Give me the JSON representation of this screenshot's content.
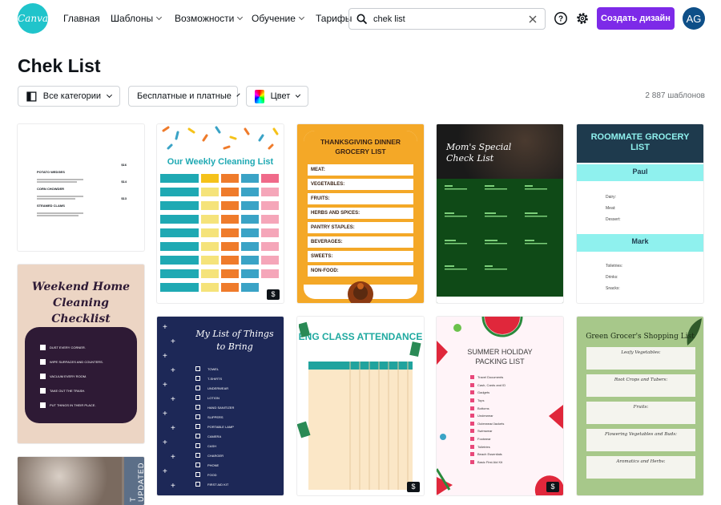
{
  "header": {
    "logo": "Canva",
    "nav": [
      "Главная",
      "Шаблоны",
      "Возможности",
      "Обучение",
      "Тарифы"
    ],
    "search_value": "chek list",
    "create_label": "Создать дизайн",
    "avatar": "AG"
  },
  "page": {
    "title": "Chek List",
    "filters": [
      "Все категории",
      "Бесплатные и платные",
      "Цвет"
    ],
    "count": "2 887 шаблонов"
  },
  "cards": {
    "menu": {
      "items": [
        {
          "name": "POTATO WEDGES",
          "price": "$16"
        },
        {
          "name": "CORN CHOWDER",
          "price": "$14"
        },
        {
          "name": "STEAMED CLAMS",
          "price": "$13"
        }
      ]
    },
    "weekend": {
      "title": "Weekend Home Cleaning Checklist",
      "items": [
        "DUST EVERY CORNER.",
        "WIPE SURFACES AND COUNTERS.",
        "VACUUM EVERY ROOM.",
        "TAKE OUT THE TRASH.",
        "PUT THINGS IN THEIR PLACE."
      ]
    },
    "updated": {
      "label": "T UPDATED"
    },
    "weekly": {
      "title": "Our Weekly Cleaning List"
    },
    "things": {
      "title": "My List of Things to Bring",
      "items": [
        "TOWEL",
        "T-SHIRTS",
        "UNDERWEAR",
        "LOTION",
        "HAND SANITIZER",
        "SLIPPERS",
        "PORTABLE LAMP",
        "CAMERA",
        "CASH",
        "CHARGER",
        "PHONE",
        "FOOD",
        "FIRST AID KIT"
      ]
    },
    "thanksgiving": {
      "title": "THANKSGIVING DINNER GROCERY LIST",
      "items": [
        "MEAT:",
        "VEGETABLES:",
        "FRUITS:",
        "HERBS AND SPICES:",
        "PANTRY STAPLES:",
        "BEVERAGES:",
        "SWEETS:",
        "NON-FOOD:"
      ]
    },
    "eng": {
      "title": "ENG CLASS ATTENDANCE"
    },
    "mom": {
      "title": "Mom's Special Check List"
    },
    "summer": {
      "title": "SUMMER HOLIDAY PACKING LIST",
      "items": [
        "Travel Documents",
        "Cash, Cards and ID",
        "Gadgets",
        "Tops",
        "Bottoms",
        "Underwear",
        "Outerwear/Jackets",
        "Swimwear",
        "Footwear",
        "Toiletries",
        "Beach Essentials",
        "Basic First Aid Kit"
      ]
    },
    "roommate": {
      "title": "ROOMMATE GROCERY LIST",
      "person1": "Paul",
      "labels1": [
        "Dairy:",
        "Meat:",
        "Dessert:"
      ],
      "person2": "Mark",
      "labels2": [
        "Toiletries:",
        "Drinks:",
        "Snacks:"
      ]
    },
    "green": {
      "title": "Green Grocer's Shopping List",
      "sections": [
        "Leafy Vegetables:",
        "Root Crops and Tubers:",
        "Fruits:",
        "Flowering Vegetables and Buds:",
        "Aromatics and Herbs:"
      ]
    }
  },
  "colors": {
    "accent": "#7d2ae8",
    "logo": "#20c4cb",
    "avatar": "#0e4f88"
  }
}
